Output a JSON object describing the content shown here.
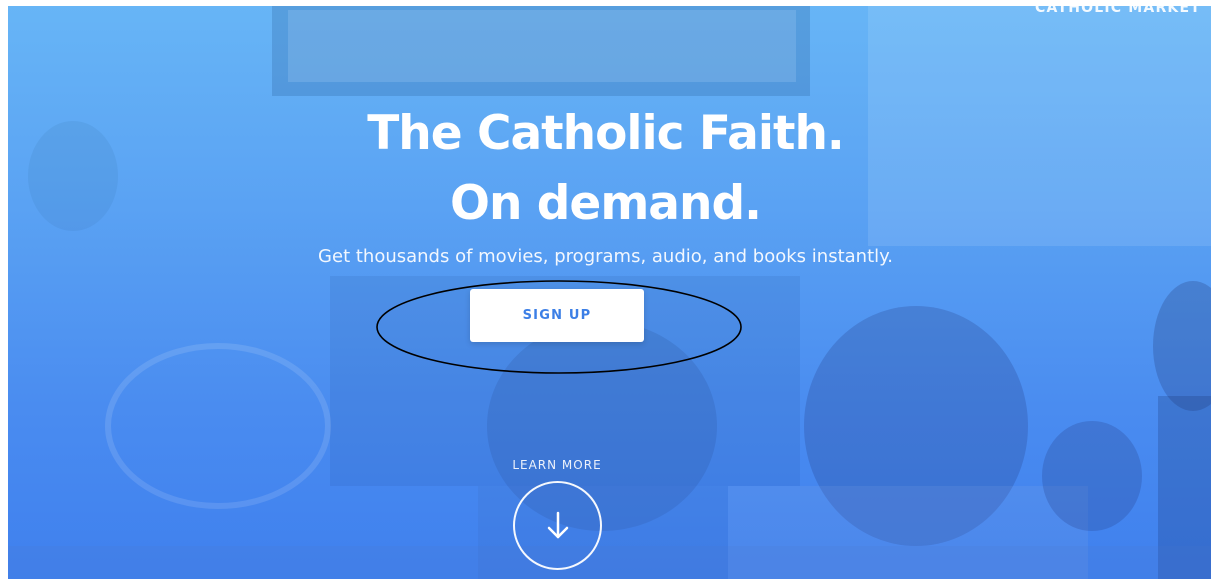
{
  "brand": {
    "name": "CATHOLIC MARKET"
  },
  "hero": {
    "headline_line1": "The Catholic Faith.",
    "headline_line2": "On demand.",
    "subheadline": "Get thousands of movies, programs, audio, and books instantly.",
    "signup_label": "SIGN UP",
    "learn_more_label": "LEARN MORE",
    "down_icon": "arrow-down-icon"
  },
  "colors": {
    "hero_top": "#67b5f6",
    "hero_bottom": "#3f80ee",
    "button_text": "#3c7fe6",
    "annotation": "#000000"
  }
}
